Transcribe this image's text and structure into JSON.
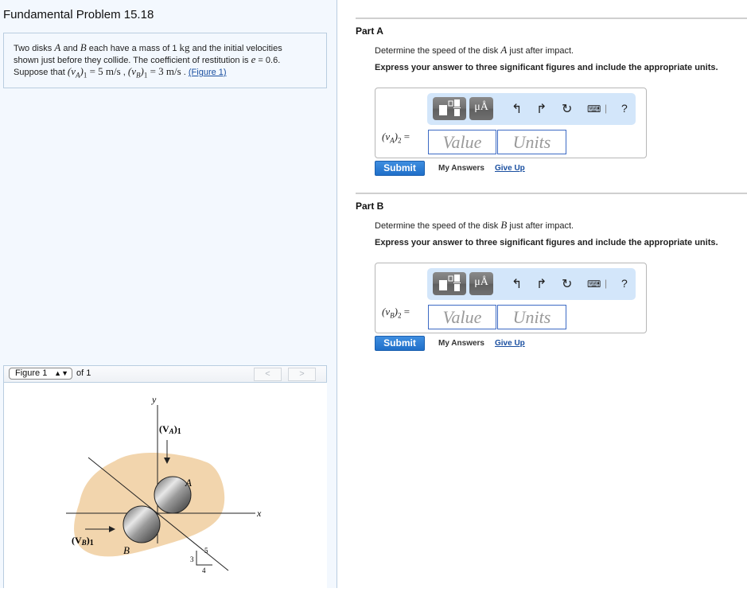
{
  "problem": {
    "title": "Fundamental Problem 15.18",
    "statement": {
      "line1_pre": "Two disks ",
      "disk_a": "A",
      "line1_mid": " and ",
      "disk_b": "B",
      "line1_post": " each have a mass of 1 ",
      "mass_unit": "kg",
      "line1_end": " and the initial velocities",
      "line2": "shown just before they collide. The coefficient of restitution is ",
      "e_symbol": "e",
      "e_value": " = 0.6.",
      "line3_pre": "Suppose that ",
      "va1_symbol": "(vA)1",
      "va1_value": " = 5  m/s",
      "sep": " , ",
      "vb1_symbol": "(vB)1",
      "vb1_value": " = 3  m/s",
      "line3_end": " . ",
      "figure_link": "(Figure 1)"
    }
  },
  "figure_viewer": {
    "selected": "Figure 1",
    "of_label": "of 1",
    "prev_label": "<",
    "next_label": ">",
    "diagram": {
      "y_axis": "y",
      "x_axis": "x",
      "va_label": "(VA)1",
      "vb_label": "(VB)1",
      "disk_a_label": "A",
      "disk_b_label": "B",
      "slope_rise": "3",
      "slope_run": "4",
      "slope_hyp": "5"
    }
  },
  "parts": [
    {
      "title": "Part A",
      "question_pre": "Determine the speed of the disk ",
      "question_var": "A",
      "question_post": " just after impact.",
      "instruction": "Express your answer to three significant figures and include the appropriate units.",
      "eq_label": "(vA)2 =",
      "value_placeholder": "Value",
      "units_placeholder": "Units",
      "submit": "Submit",
      "my_answers": "My Answers",
      "give_up": "Give Up"
    },
    {
      "title": "Part B",
      "question_pre": "Determine the speed of the disk ",
      "question_var": "B",
      "question_post": " just after impact.",
      "instruction": "Express your answer to three significant figures and include the appropriate units.",
      "eq_label": "(vB)2 =",
      "value_placeholder": "Value",
      "units_placeholder": "Units",
      "submit": "Submit",
      "my_answers": "My Answers",
      "give_up": "Give Up"
    }
  ],
  "toolbar": {
    "units_label": "μÅ",
    "icons": [
      "templates-icon",
      "units-icon",
      "undo-icon",
      "redo-icon",
      "reset-icon",
      "keyboard-icon",
      "help-icon"
    ],
    "help_label": "?"
  }
}
